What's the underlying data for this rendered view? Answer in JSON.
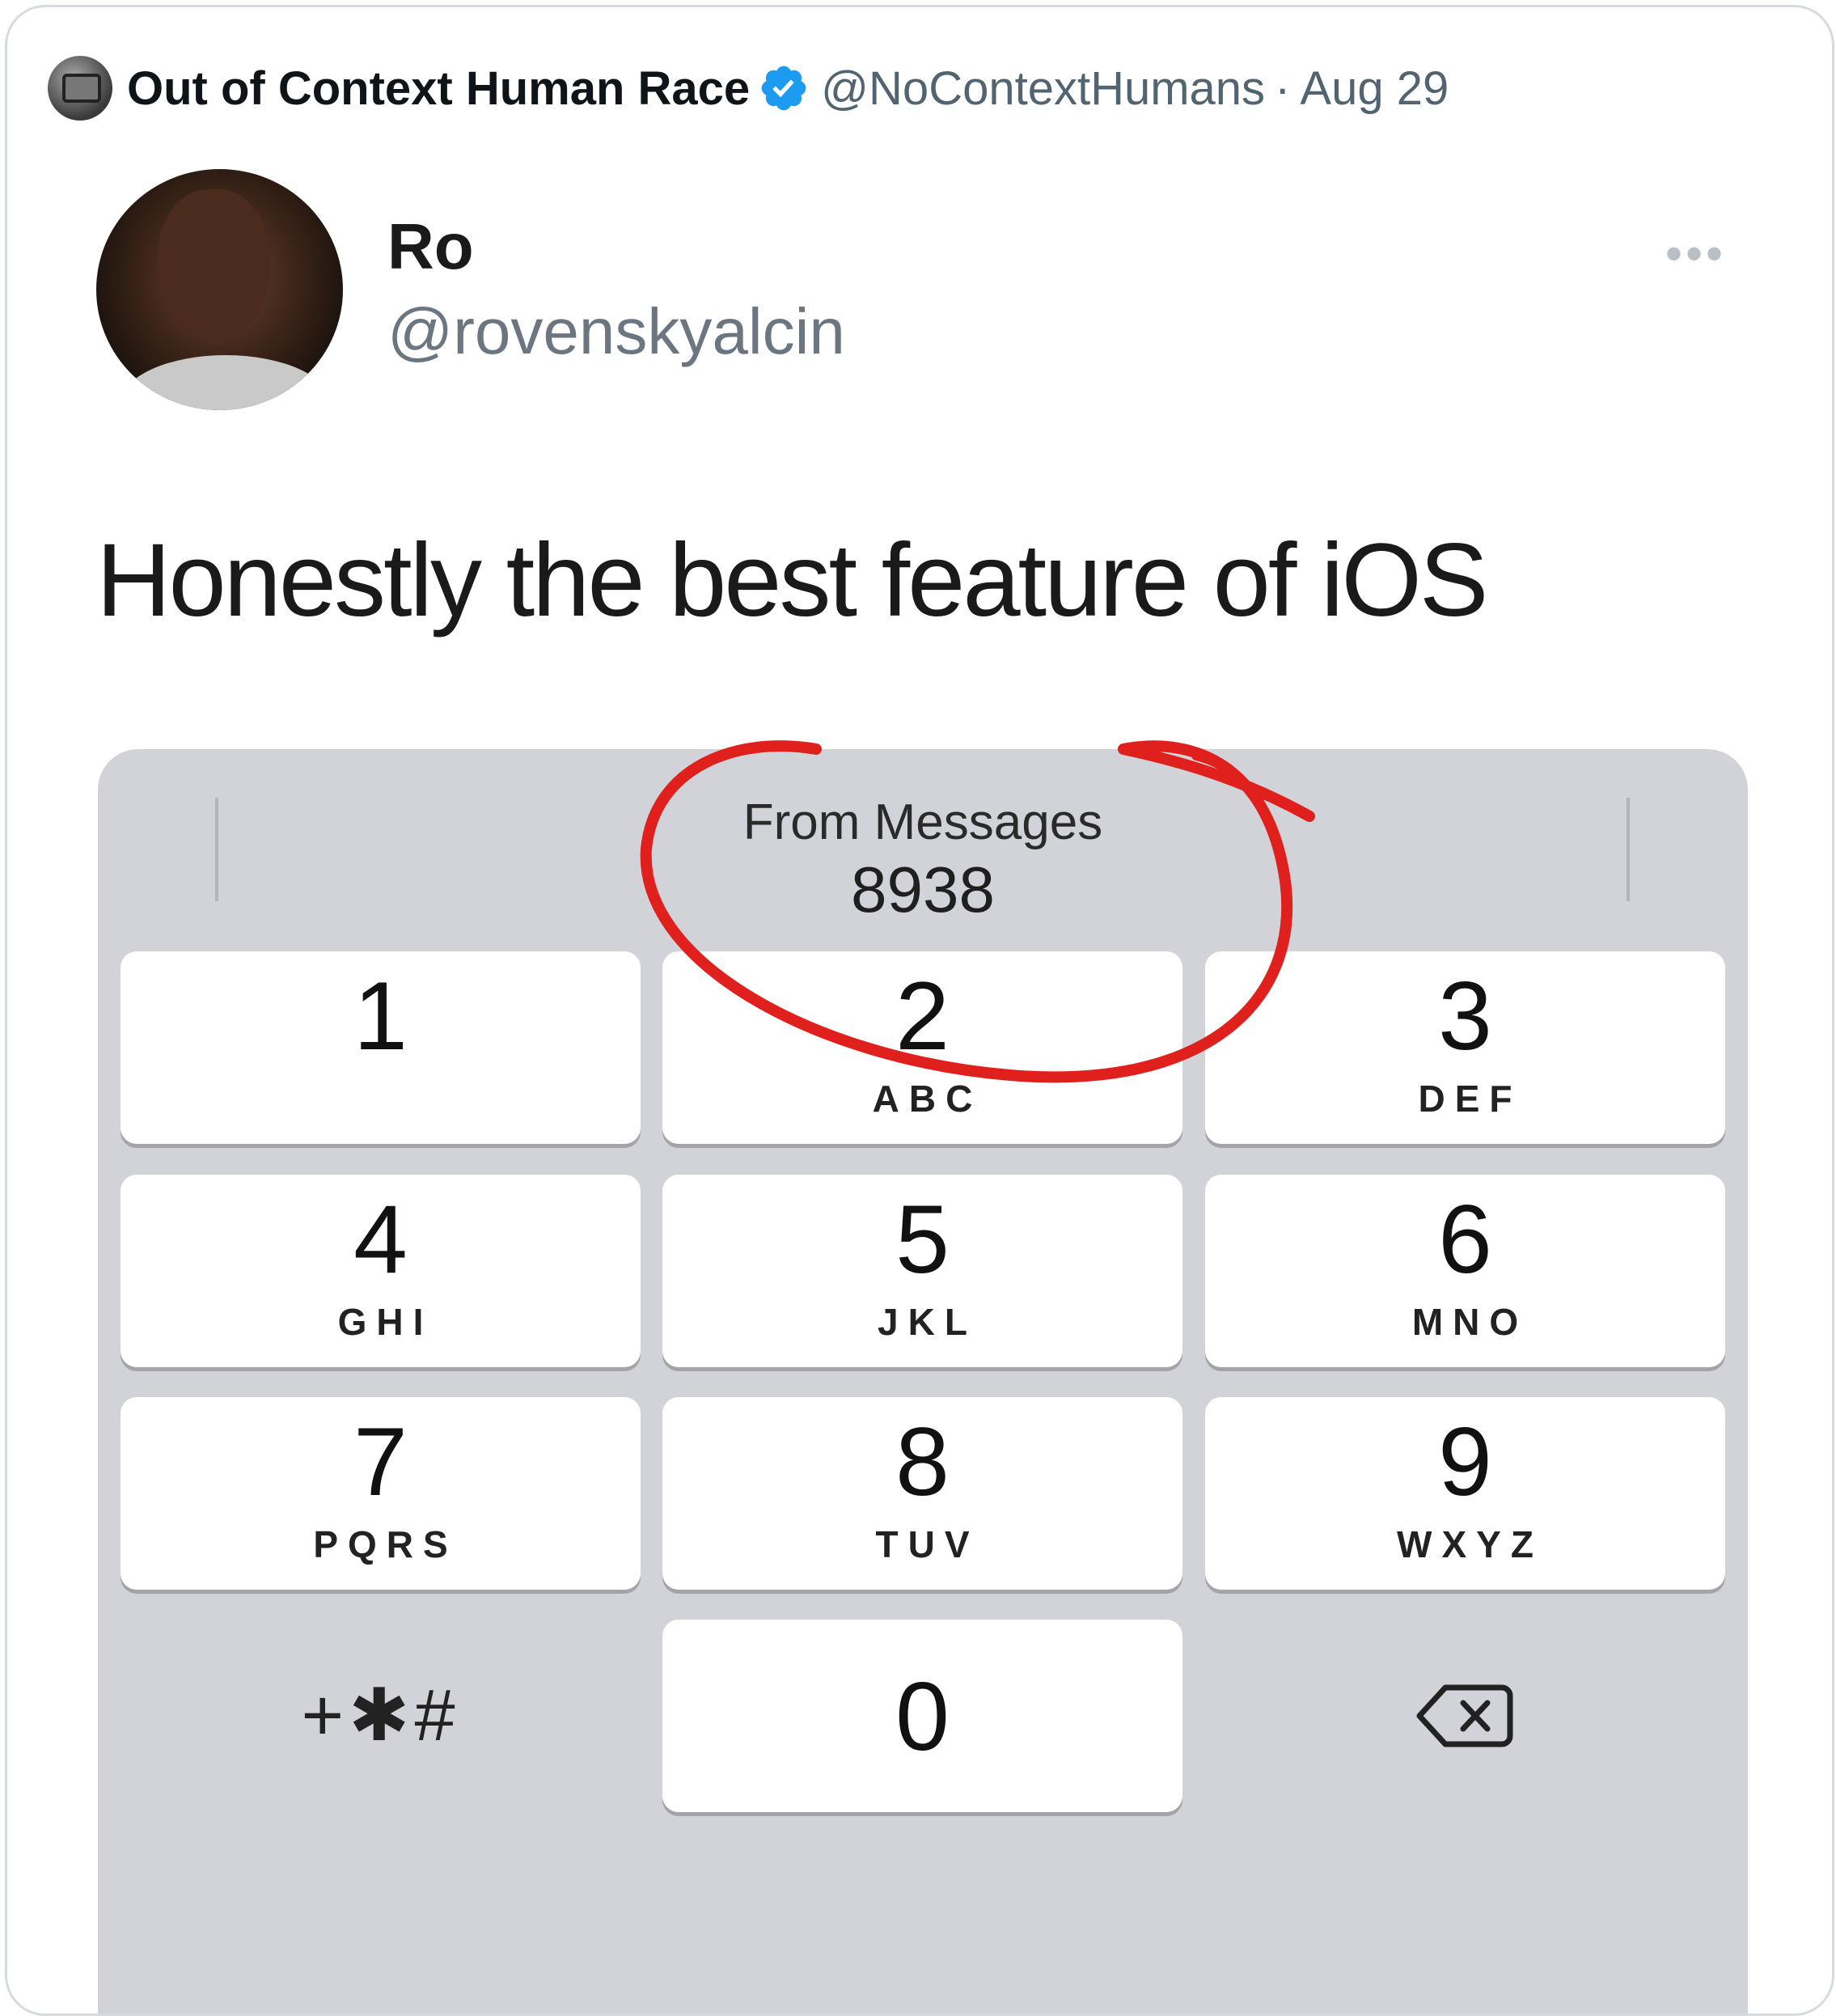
{
  "quote_header": {
    "name": "Out of Context Human Race",
    "handle": "@NoContextHumans",
    "separator": "·",
    "date": "Aug 29"
  },
  "icons": {
    "verified": "verified-badge-icon",
    "more": "more-horizontal-icon",
    "backspace": "backspace-icon"
  },
  "colors": {
    "verified_blue": "#1d9bf0",
    "circle_red": "#e0201c",
    "keypad_bg": "#d2d3d8"
  },
  "tweet": {
    "name": "Ro",
    "handle": "@rovenskyalcin",
    "more": "•••",
    "text": "Honestly the best feature of iOS"
  },
  "keypad": {
    "suggestion_label": "From Messages",
    "suggestion_code": "8938",
    "keys": [
      {
        "num": "1",
        "letters": ""
      },
      {
        "num": "2",
        "letters": "ABC"
      },
      {
        "num": "3",
        "letters": "DEF"
      },
      {
        "num": "4",
        "letters": "GHI"
      },
      {
        "num": "5",
        "letters": "JKL"
      },
      {
        "num": "6",
        "letters": "MNO"
      },
      {
        "num": "7",
        "letters": "PQRS"
      },
      {
        "num": "8",
        "letters": "TUV"
      },
      {
        "num": "9",
        "letters": "WXYZ"
      }
    ],
    "symbols": "+✱#",
    "zero": "0"
  }
}
